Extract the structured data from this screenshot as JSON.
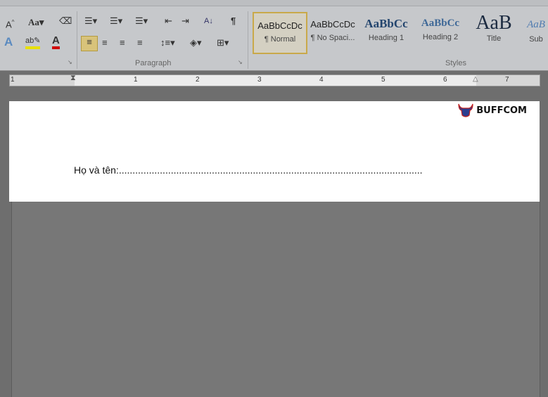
{
  "ribbon": {
    "paragraph_group": "Paragraph",
    "styles_group": "Styles",
    "font_icons": [
      "grow-font-icon",
      "change-case-icon",
      "clear-formatting-icon",
      "text-effects-icon",
      "highlight-icon",
      "font-color-icon"
    ],
    "change_case_label": "Aa",
    "highlight_label": "ab",
    "font_color_label": "A",
    "pilcrow": "¶",
    "sort_label": "A↓",
    "styles": [
      {
        "preview": "AaBbCcDc",
        "label": "¶ Normal",
        "selected": true
      },
      {
        "preview": "AaBbCcDc",
        "label": "¶ No Spaci..."
      },
      {
        "preview": "AaBbCc",
        "label": "Heading 1"
      },
      {
        "preview": "AaBbCc",
        "label": "Heading 2"
      },
      {
        "preview": "AaB",
        "label": "Title"
      },
      {
        "preview": "AaB",
        "label": "Sub"
      }
    ],
    "colors": {
      "highlight": "#e8e000",
      "font_color": "#d00000",
      "selected_border": "#c9a94a"
    }
  },
  "ruler": {
    "numbers": [
      "1",
      "1",
      "2",
      "3",
      "4",
      "5",
      "6",
      "7"
    ]
  },
  "document": {
    "text": "Họ và tên:...............................................................................................................",
    "logo": "BUFFCOM"
  }
}
